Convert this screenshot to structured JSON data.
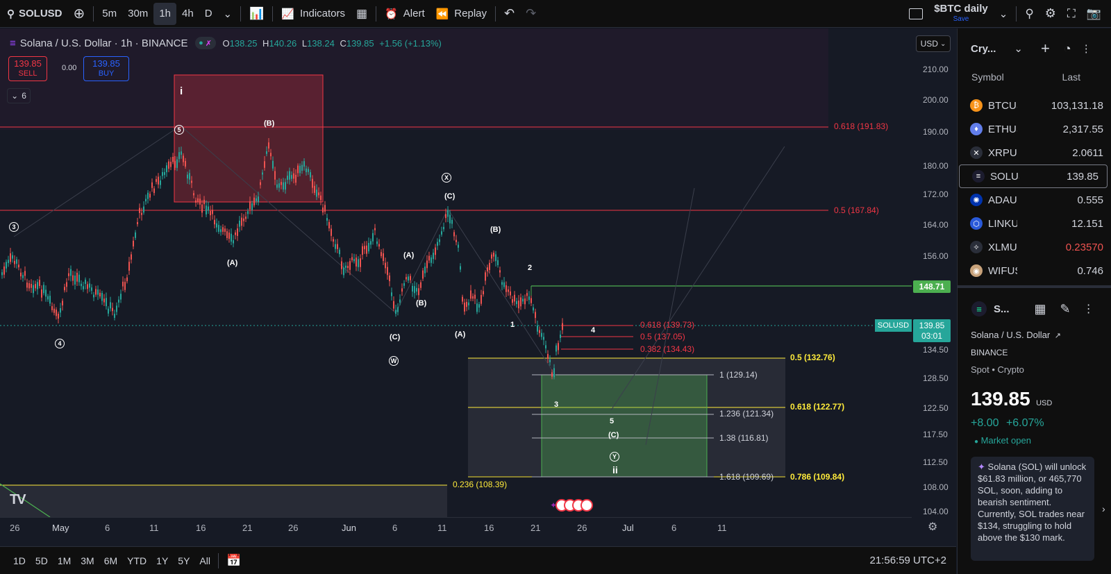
{
  "topbar": {
    "symbol": "SOLUSD",
    "intervals": [
      "5m",
      "30m",
      "1h",
      "4h",
      "D"
    ],
    "active_interval": "1h",
    "indicators": "Indicators",
    "alert": "Alert",
    "replay": "Replay",
    "layout_name": "$BTC daily",
    "layout_save": "Save"
  },
  "legend": {
    "title": "Solana / U.S. Dollar · 1h · BINANCE",
    "o_label": "O",
    "o": "138.25",
    "h_label": "H",
    "h": "140.26",
    "l_label": "L",
    "l": "138.24",
    "c_label": "C",
    "c": "139.85",
    "change": "+1.56 (+1.13%)",
    "sell_price": "139.85",
    "sell_label": "SELL",
    "spread": "0.00",
    "buy_price": "139.85",
    "buy_label": "BUY",
    "indicators_count": "6"
  },
  "currency": "USD",
  "price_axis": [
    "210.00",
    "200.00",
    "190.00",
    "180.00",
    "172.00",
    "164.00",
    "156.00",
    "134.50",
    "128.50",
    "122.50",
    "117.50",
    "112.50",
    "108.00",
    "104.00"
  ],
  "price_tags": {
    "line_148": "148.71",
    "current_symbol": "SOLUSD",
    "current_price": "139.85",
    "countdown": "03:01"
  },
  "time_axis": [
    "26",
    "May",
    "6",
    "11",
    "16",
    "21",
    "26",
    "Jun",
    "6",
    "11",
    "16",
    "21",
    "26",
    "Jul",
    "6",
    "11"
  ],
  "fib_levels": {
    "f618_191": "0.618 (191.83)",
    "f5_167": "0.5 (167.84)",
    "f618_139": "0.618 (139.73)",
    "f5_137": "0.5 (137.05)",
    "f382_134": "0.382 (134.43)",
    "f5_132": "0.5 (132.76)",
    "f1_129": "1 (129.14)",
    "f618_122": "0.618 (122.77)",
    "f1236_121": "1.236 (121.34)",
    "f138_116": "1.38 (116.81)",
    "f1618_109": "1.618 (109.69)",
    "f786_109": "0.786 (109.84)",
    "f236_108": "0.236 (108.39)"
  },
  "waves": {
    "i": "i",
    "w5": "5",
    "B1": "(B)",
    "w3": "3",
    "A1": "(A)",
    "w4": "4",
    "X": "X",
    "C1": "(C)",
    "A2": "(A)",
    "B2": "(B)",
    "C2": "(C)",
    "W": "W",
    "B3": "(B)",
    "A3": "(A)",
    "n2": "2",
    "n1": "1",
    "n4": "4",
    "n3": "3",
    "n5": "5",
    "C3": "(C)",
    "Y": "Y",
    "ii": "ii"
  },
  "bottombar": {
    "ranges": [
      "1D",
      "5D",
      "1M",
      "3M",
      "6M",
      "YTD",
      "1Y",
      "5Y",
      "All"
    ],
    "clock": "21:56:59 UTC+2"
  },
  "watchlist": {
    "name": "Cry...",
    "col_symbol": "Symbol",
    "col_last": "Last",
    "items": [
      {
        "sym": "BTCUSD",
        "last": "103,131.18",
        "color": "#f7931a",
        "glyph": "₿"
      },
      {
        "sym": "ETHUSD",
        "last": "2,317.55",
        "color": "#627eea",
        "glyph": "♦"
      },
      {
        "sym": "XRPUSD",
        "last": "2.0611",
        "color": "#2a2e39",
        "glyph": "✕"
      },
      {
        "sym": "SOLUSD",
        "last": "139.85",
        "color": "#1c1c2e",
        "glyph": "≡"
      },
      {
        "sym": "ADAUSD",
        "last": "0.555",
        "color": "#0033ad",
        "glyph": "✺"
      },
      {
        "sym": "LINKUSD",
        "last": "12.151",
        "color": "#2a5ada",
        "glyph": "⬡"
      },
      {
        "sym": "XLMUSD",
        "last": "0.23570",
        "color": "#2a2e39",
        "glyph": "✧"
      },
      {
        "sym": "WIFUSD",
        "last": "0.746",
        "color": "#c8a27a",
        "glyph": "◉"
      }
    ]
  },
  "details": {
    "short": "S...",
    "name": "Solana / U.S. Dollar",
    "exchange": "BINANCE",
    "type": "Spot • Crypto",
    "price": "139.85",
    "currency": "USD",
    "change": "+8.00",
    "change_pct": "+6.07%",
    "market": "Market open",
    "news": "Solana (SOL) will unlock $61.83 million, or 465,770 SOL, soon, adding to bearish sentiment. Currently, SOL trades near $134, struggling to hold above the $130 mark."
  },
  "colors": {
    "up": "#26a69a",
    "down": "#ef5350",
    "fib_red": "#f23645",
    "fib_yellow": "#ffeb3b",
    "green": "#4caf50"
  }
}
